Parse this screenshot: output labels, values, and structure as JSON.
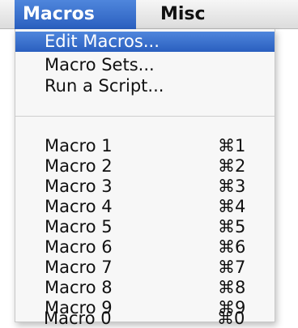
{
  "menubar": {
    "items": [
      {
        "label": "Macros",
        "active": true
      },
      {
        "label": "Misc",
        "active": false
      }
    ]
  },
  "menu": {
    "top_items": [
      {
        "label": "Edit Macros...",
        "highlighted": true
      },
      {
        "label": "Macro Sets...",
        "highlighted": false
      },
      {
        "label": "Run a Script...",
        "highlighted": false
      }
    ],
    "macros": [
      {
        "label": "Macro 1",
        "shortcut": "⌘1"
      },
      {
        "label": "Macro 2",
        "shortcut": "⌘2"
      },
      {
        "label": "Macro 3",
        "shortcut": "⌘3"
      },
      {
        "label": "Macro 4",
        "shortcut": "⌘4"
      },
      {
        "label": "Macro 5",
        "shortcut": "⌘5"
      },
      {
        "label": "Macro 6",
        "shortcut": "⌘6"
      },
      {
        "label": "Macro 7",
        "shortcut": "⌘7"
      },
      {
        "label": "Macro 8",
        "shortcut": "⌘8"
      },
      {
        "label": "Macro 9",
        "shortcut": "⌘9"
      },
      {
        "label": "Macro 0",
        "shortcut": "⌘0"
      }
    ]
  },
  "colors": {
    "highlight": "#2a5fbf",
    "menu_background": "#f7f7f7",
    "text": "#111111"
  }
}
